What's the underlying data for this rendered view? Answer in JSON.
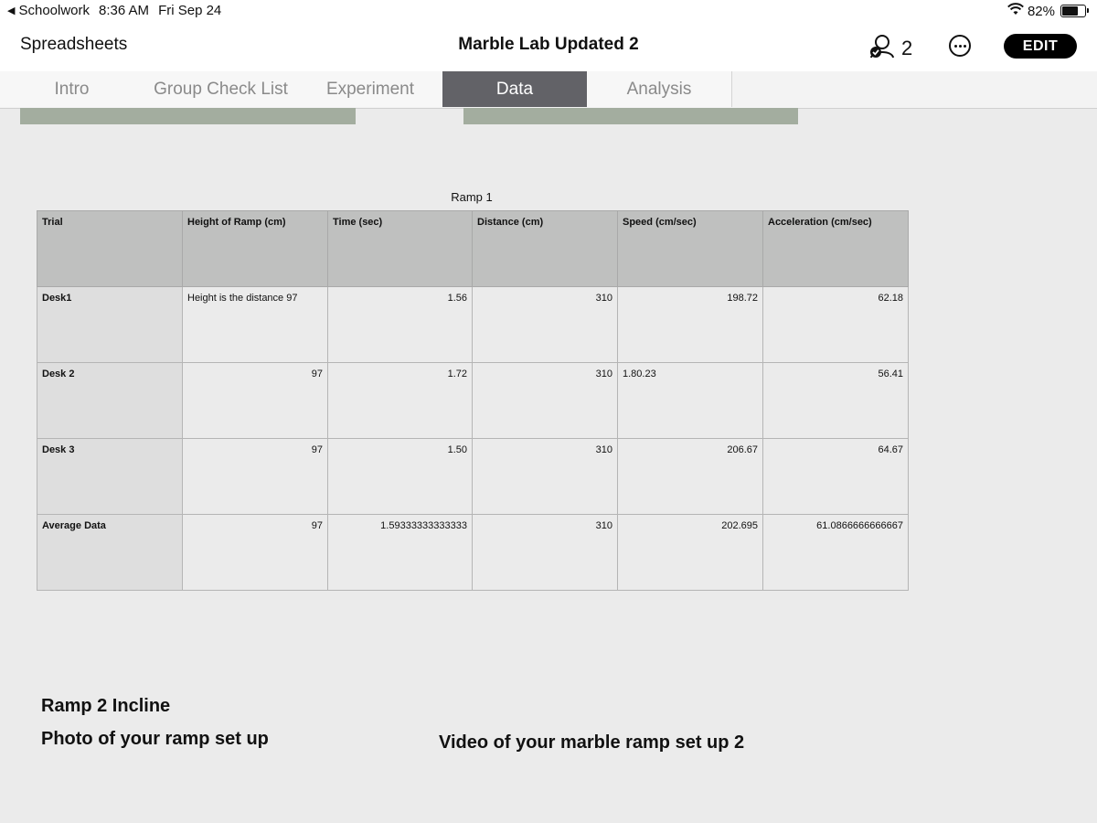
{
  "status_bar": {
    "back_app": "Schoolwork",
    "time": "8:36 AM",
    "date": "Fri Sep 24",
    "battery": "82%",
    "battery_level": 0.82
  },
  "nav": {
    "back_label": "Spreadsheets",
    "title": "Marble Lab Updated 2",
    "collaborator_count": "2",
    "edit_label": "EDIT"
  },
  "tabs": [
    {
      "label": "Intro",
      "active": false
    },
    {
      "label": "Group Check List",
      "active": false
    },
    {
      "label": "Experiment",
      "active": false
    },
    {
      "label": "Data",
      "active": true
    },
    {
      "label": "Analysis",
      "active": false
    }
  ],
  "sheet": {
    "table_title": "Ramp 1",
    "headers": [
      "Trial",
      "Height of Ramp (cm)",
      "Time (sec)",
      "Distance (cm)",
      "Speed (cm/sec)",
      "Acceleration (cm/sec)"
    ],
    "rows": [
      [
        "Desk1",
        "Height is the distance 97",
        "1.56",
        "310",
        "198.72",
        "62.18"
      ],
      [
        "Desk 2",
        "97",
        "1.72",
        "310",
        "1.80.23",
        "56.41"
      ],
      [
        "Desk 3",
        "97",
        "1.50",
        "310",
        "206.67",
        "64.67"
      ],
      [
        "Average Data",
        "97",
        "1.59333333333333",
        "310",
        "202.695",
        "61.0866666666667"
      ]
    ],
    "ramp2_heading": "Ramp 2 Incline",
    "photo_label": "Photo of your ramp set up",
    "video_label": "Video of your marble ramp set up 2"
  },
  "colors": {
    "active_tab": "#626267",
    "header_fill": "#bfc0bf",
    "strip_fill": "#a3ad9f"
  }
}
